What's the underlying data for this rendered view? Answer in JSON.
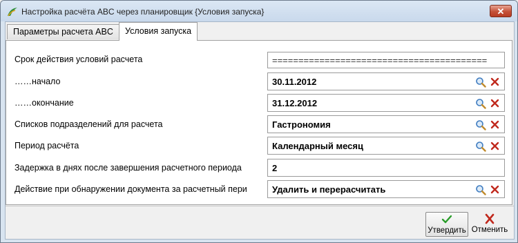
{
  "window": {
    "title": "Настройка расчёта ABC через планировщик {Условия запуска}",
    "close_label": "✕"
  },
  "tabs": [
    {
      "label": "Параметры расчета ABC",
      "active": false
    },
    {
      "label": "Условия запуска",
      "active": true
    }
  ],
  "fields": [
    {
      "label": "Срок действия условий расчета",
      "value": "========================================="
    },
    {
      "label": "……начало",
      "value": "30.11.2012"
    },
    {
      "label": "……окончание",
      "value": "31.12.2012"
    },
    {
      "label": "Списков подразделений для расчета",
      "value": "Гастрономия"
    },
    {
      "label": "Период расчёта",
      "value": "Календарный месяц"
    },
    {
      "label": "Задержка в днях после завершения расчетного периода",
      "value": "2"
    },
    {
      "label": "Действие при обнаружении документа за расчетный пери",
      "value": "Удалить и перерасчитать"
    }
  ],
  "buttons": {
    "confirm_label": "Утвердить",
    "cancel_label": "Отменить"
  },
  "colors": {
    "confirm_icon": "#2a9d2a",
    "cancel_icon": "#c0281c",
    "lookup_icon": "#3f7cc0"
  }
}
